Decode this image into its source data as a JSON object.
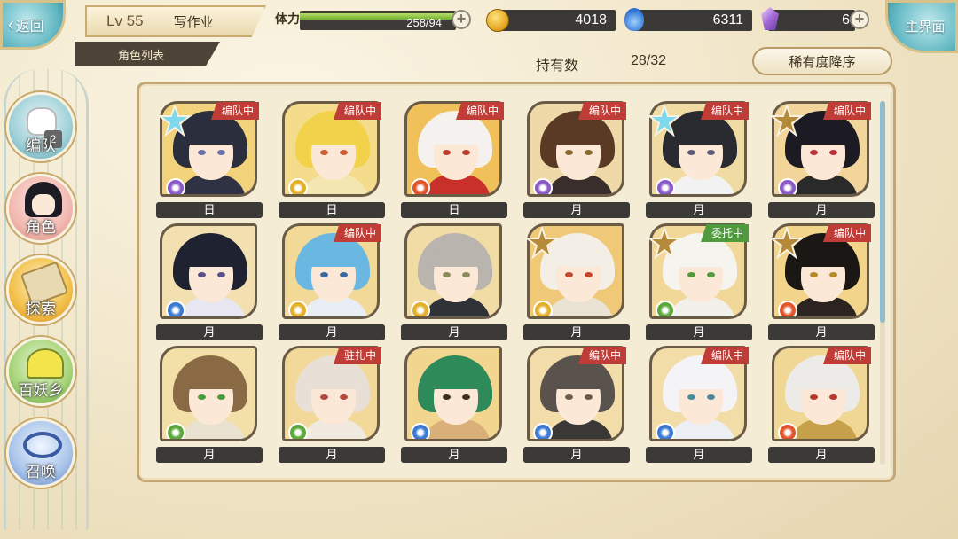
{
  "header": {
    "back_label": "返回",
    "home_label": "主界面",
    "level": "Lv 55",
    "player_name": "写作业",
    "subtitle": "角色列表",
    "stamina_label": "体力",
    "stamina_text": "258/94",
    "stamina_fraction": 1.0,
    "coins": "4018",
    "souls": "6311",
    "crystals": "6"
  },
  "toolbar": {
    "owned_label": "持有数",
    "owned_count": "28/32",
    "sort_label": "稀有度降序"
  },
  "nav": [
    {
      "label": "编队",
      "icon": "team-icon",
      "badge": "2"
    },
    {
      "label": "角色",
      "icon": "character-icon"
    },
    {
      "label": "探索",
      "icon": "explore-icon"
    },
    {
      "label": "百妖乡",
      "icon": "village-icon"
    },
    {
      "label": "召唤",
      "icon": "summon-icon"
    }
  ],
  "colors": {
    "accent": "#5fb6c2",
    "badge_red": "#c03c36",
    "badge_green": "#4e9a3c",
    "stamina_green": "#8ac746"
  },
  "characters": [
    {
      "rank": "日",
      "status": "编队中",
      "status_color": "red",
      "rarity": "cyan-star",
      "element": "purple",
      "hair": "#2b2e3c",
      "bg": "#f2d27a",
      "eye": "#6a6fb0",
      "outfit": "#2f3242"
    },
    {
      "rank": "日",
      "status": "编队中",
      "status_color": "red",
      "rarity": "",
      "element": "gold",
      "hair": "#f2d24a",
      "bg": "#f4dc8c",
      "eye": "#d15c2e",
      "outfit": "#f4e6b0"
    },
    {
      "rank": "日",
      "status": "编队中",
      "status_color": "red",
      "rarity": "",
      "element": "fire",
      "hair": "#f4f1ef",
      "bg": "#f0c15a",
      "eye": "#c23a2e",
      "outfit": "#c8302a"
    },
    {
      "rank": "月",
      "status": "编队中",
      "status_color": "red",
      "rarity": "",
      "element": "purple",
      "hair": "#5b3a25",
      "bg": "#f0d9a8",
      "eye": "#8a6a2a",
      "outfit": "#3a2e2c"
    },
    {
      "rank": "月",
      "status": "编队中",
      "status_color": "red",
      "rarity": "cyan-star",
      "element": "purple",
      "hair": "#2a2b30",
      "bg": "#f0dba3",
      "eye": "#5b5c7a",
      "outfit": "#f2f2f2"
    },
    {
      "rank": "月",
      "status": "编队中",
      "status_color": "red",
      "rarity": "gold-star",
      "element": "purple",
      "hair": "#1c1a22",
      "bg": "#f1d59a",
      "eye": "#c0303a",
      "outfit": "#2b2a2a"
    },
    {
      "rank": "月",
      "status": "",
      "status_color": "",
      "rarity": "",
      "element": "blue",
      "hair": "#1f2230",
      "bg": "#f3e0b0",
      "eye": "#5a4f8a",
      "outfit": "#e8e6f0"
    },
    {
      "rank": "月",
      "status": "编队中",
      "status_color": "red",
      "rarity": "",
      "element": "gold",
      "hair": "#6ab8e2",
      "bg": "#f2d998",
      "eye": "#3a6aa0",
      "outfit": "#e9eef4"
    },
    {
      "rank": "月",
      "status": "",
      "status_color": "",
      "rarity": "",
      "element": "gold",
      "hair": "#b9b4ad",
      "bg": "#f1dca6",
      "eye": "#8a8a5a",
      "outfit": "#2f3338"
    },
    {
      "rank": "月",
      "status": "",
      "status_color": "",
      "rarity": "gold-star",
      "element": "gold",
      "hair": "#f3efe6",
      "bg": "#f0c978",
      "eye": "#c2472e",
      "outfit": "#eae2d2"
    },
    {
      "rank": "月",
      "status": "委托中",
      "status_color": "green",
      "rarity": "gold-star",
      "element": "green",
      "hair": "#f6f4ef",
      "bg": "#f2d898",
      "eye": "#4f9a3a",
      "outfit": "#f2f0ea"
    },
    {
      "rank": "月",
      "status": "编队中",
      "status_color": "red",
      "rarity": "gold-star",
      "element": "fire",
      "hair": "#1a1714",
      "bg": "#f2d48a",
      "eye": "#b58a2a",
      "outfit": "#2b2420"
    },
    {
      "rank": "月",
      "status": "",
      "status_color": "",
      "rarity": "",
      "element": "green",
      "hair": "#8a6a44",
      "bg": "#f3dfa8",
      "eye": "#4a9a3a",
      "outfit": "#e9e2d0"
    },
    {
      "rank": "月",
      "status": "驻扎中",
      "status_color": "red",
      "rarity": "",
      "element": "green",
      "hair": "#e8e0d6",
      "bg": "#f2d999",
      "eye": "#b24a3a",
      "outfit": "#efe9df"
    },
    {
      "rank": "月",
      "status": "",
      "status_color": "",
      "rarity": "",
      "element": "blue",
      "hair": "#2f8a5a",
      "bg": "#f2d690",
      "eye": "#3a3020",
      "outfit": "#d9b07a"
    },
    {
      "rank": "月",
      "status": "编队中",
      "status_color": "red",
      "rarity": "",
      "element": "blue",
      "hair": "#5a524c",
      "bg": "#f2dcaa",
      "eye": "#6a5a4a",
      "outfit": "#3a3836"
    },
    {
      "rank": "月",
      "status": "编队中",
      "status_color": "red",
      "rarity": "",
      "element": "blue",
      "hair": "#f4f3f6",
      "bg": "#f2dca8",
      "eye": "#4a8a9a",
      "outfit": "#eceff4"
    },
    {
      "rank": "月",
      "status": "编队中",
      "status_color": "red",
      "rarity": "",
      "element": "fire",
      "hair": "#ecebe8",
      "bg": "#f1d795",
      "eye": "#b23a2e",
      "outfit": "#c7a04a"
    }
  ]
}
